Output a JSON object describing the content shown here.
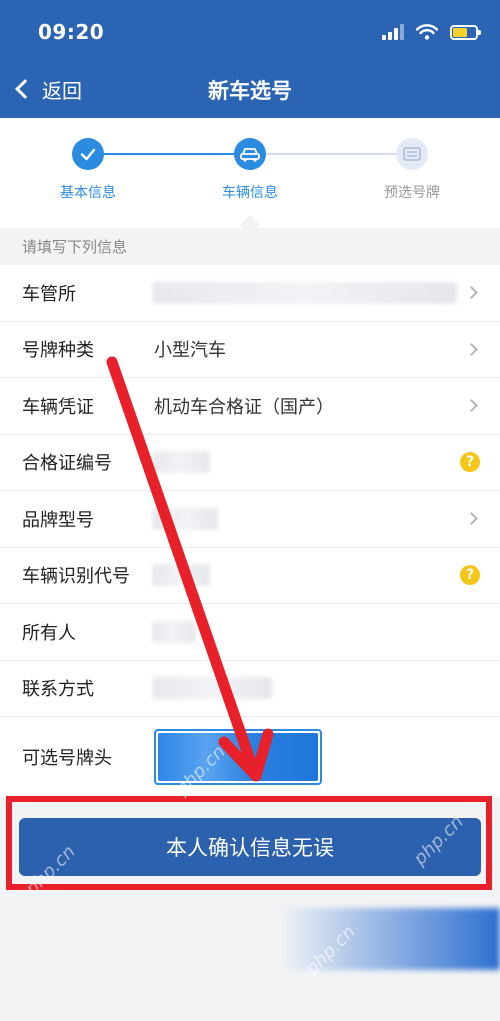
{
  "status_bar": {
    "time": "09:20"
  },
  "nav": {
    "back_label": "返回",
    "title": "新车选号"
  },
  "steps": [
    {
      "label": "基本信息",
      "state": "done"
    },
    {
      "label": "车辆信息",
      "state": "current"
    },
    {
      "label": "预选号牌",
      "state": "pending"
    }
  ],
  "form": {
    "hint": "请填写下列信息",
    "rows": [
      {
        "label": "车管所",
        "value": "",
        "trailing": "chevron"
      },
      {
        "label": "号牌种类",
        "value": "小型汽车",
        "trailing": "chevron"
      },
      {
        "label": "车辆凭证",
        "value": "机动车合格证（国产）",
        "trailing": "chevron"
      },
      {
        "label": "合格证编号",
        "value": "",
        "trailing": "help"
      },
      {
        "label": "品牌型号",
        "value": "",
        "trailing": "chevron"
      },
      {
        "label": "车辆识别代号",
        "value": "",
        "trailing": "help"
      },
      {
        "label": "所有人",
        "value": ""
      },
      {
        "label": "联系方式",
        "value": ""
      },
      {
        "label": "可选号牌头",
        "value": ""
      }
    ]
  },
  "confirm": {
    "label": "本人确认信息无误"
  },
  "help_glyph": "?",
  "watermark": "php.cn",
  "colors": {
    "header": "#2b64b3",
    "accent": "#2a8be0",
    "confirm_button": "#2c61ad",
    "annotation_red": "#e8202a",
    "help_icon": "#f5c518"
  }
}
